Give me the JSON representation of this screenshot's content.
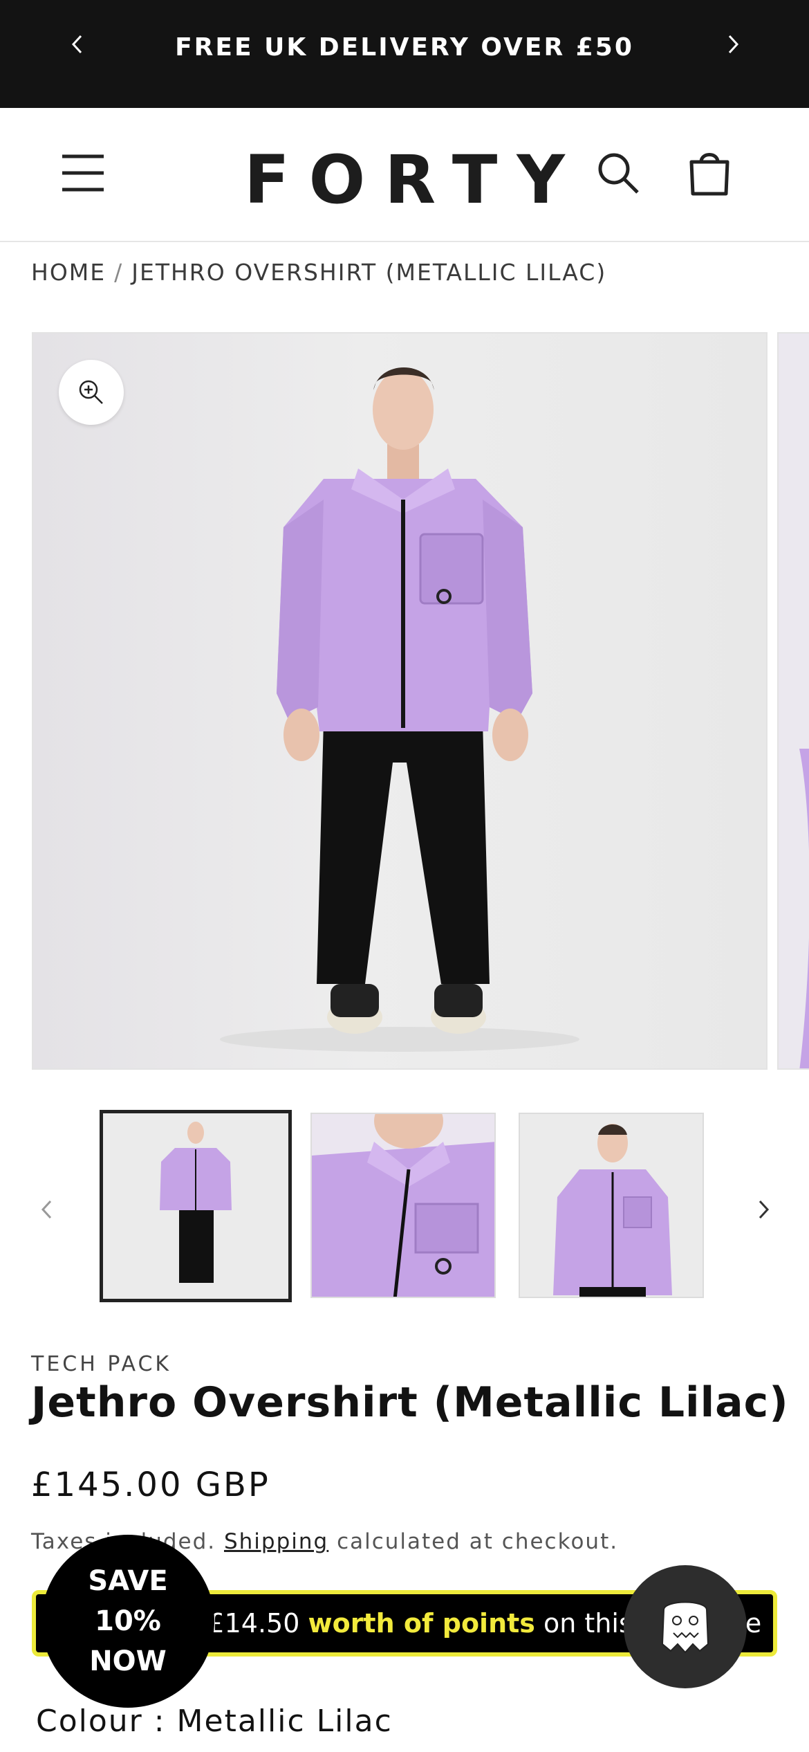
{
  "announcement": {
    "text": "FREE UK DELIVERY OVER £50",
    "prev_icon": "chevron-left-icon",
    "next_icon": "chevron-right-icon"
  },
  "header": {
    "logo": "FORTY",
    "menu_icon": "hamburger-menu-icon",
    "search_icon": "search-icon",
    "cart_icon": "cart-icon"
  },
  "breadcrumb": {
    "home": "HOME",
    "separator": "/",
    "current": "JETHRO OVERSHIRT (METALLIC LILAC)"
  },
  "gallery": {
    "zoom_icon": "zoom-in-icon",
    "prev_icon": "chevron-left-icon",
    "next_icon": "chevron-right-icon"
  },
  "product": {
    "vendor": "TECH PACK",
    "title": "Jethro Overshirt (Metallic Lilac)",
    "price": "£145.00 GBP",
    "tax_prefix": "Taxes included.",
    "tax_link": "Shipping",
    "tax_suffix": "calculated at checkout.",
    "colour_label": "Colour : Metallic Lilac"
  },
  "points_banner": {
    "prefix": "Earn £14.50",
    "highlight": "worth of points",
    "suffix": "on this purchase"
  },
  "save_badge": {
    "line1": "SAVE",
    "line2": "10%",
    "line3": "NOW"
  },
  "colors": {
    "announcement_bg": "#131313",
    "points_border": "#ecea3a",
    "points_highlight": "#f2ea3c",
    "jacket": "#c5a3e6"
  }
}
